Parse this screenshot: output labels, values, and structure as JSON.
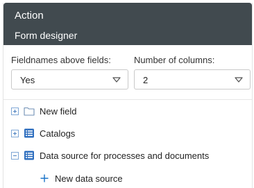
{
  "header": {
    "title": "Action",
    "subtitle": "Form designer"
  },
  "form": {
    "fieldnames_label": "Fieldnames above fields:",
    "fieldnames_value": "Yes",
    "columns_label": "Number of columns:",
    "columns_value": "2"
  },
  "tree": {
    "items": [
      {
        "label": "New field",
        "icon": "folder-icon",
        "expanded": false
      },
      {
        "label": "Catalogs",
        "icon": "list-icon",
        "expanded": false
      },
      {
        "label": "Data source for processes and documents",
        "icon": "list-icon",
        "expanded": true
      }
    ],
    "child_action": {
      "label": "New data source",
      "icon": "plus-icon"
    }
  },
  "colors": {
    "header_bg": "#414a4f",
    "accent": "#1a73c8"
  }
}
